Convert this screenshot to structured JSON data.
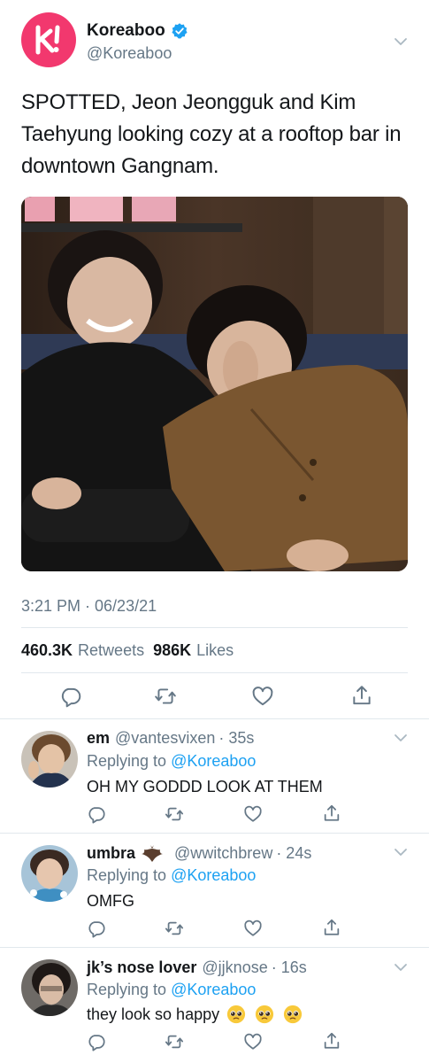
{
  "main_tweet": {
    "author_name": "Koreaboo",
    "author_handle": "@Koreaboo",
    "text": "SPOTTED, Jeon Jeongguk and Kim Taehyung looking cozy at a rooftop bar in downtown Gangnam.",
    "timestamp": "3:21 PM · 06/23/21",
    "retweets_count": "460.3K",
    "retweets_label": "Retweets",
    "likes_count": "986K",
    "likes_label": "Likes"
  },
  "replies": [
    {
      "name": "em",
      "handle": "@vantesvixen",
      "time": "· 35s",
      "replying_prefix": "Replying to",
      "replying_to": "@Koreaboo",
      "text": "OH MY GODDD LOOK AT THEM"
    },
    {
      "name": "umbra",
      "handle": "@wwitchbrew",
      "time": "· 24s",
      "replying_prefix": "Replying to",
      "replying_to": "@Koreaboo",
      "text": "OMFG"
    },
    {
      "name": "jk’s nose lover",
      "handle": "@jjknose",
      "time": "· 16s",
      "replying_prefix": "Replying to",
      "replying_to": "@Koreaboo",
      "text": "they look so happy"
    }
  ],
  "icons": [
    "verified-badge-icon",
    "chevron-down-icon",
    "reply-icon",
    "retweet-icon",
    "like-icon",
    "share-icon",
    "bat-emoji-icon",
    "pleading-face-emoji-icon"
  ],
  "colors": {
    "link": "#1da1f2",
    "secondary_text": "#657786",
    "brand": "#f2386e",
    "divider": "#e1e8ed"
  }
}
